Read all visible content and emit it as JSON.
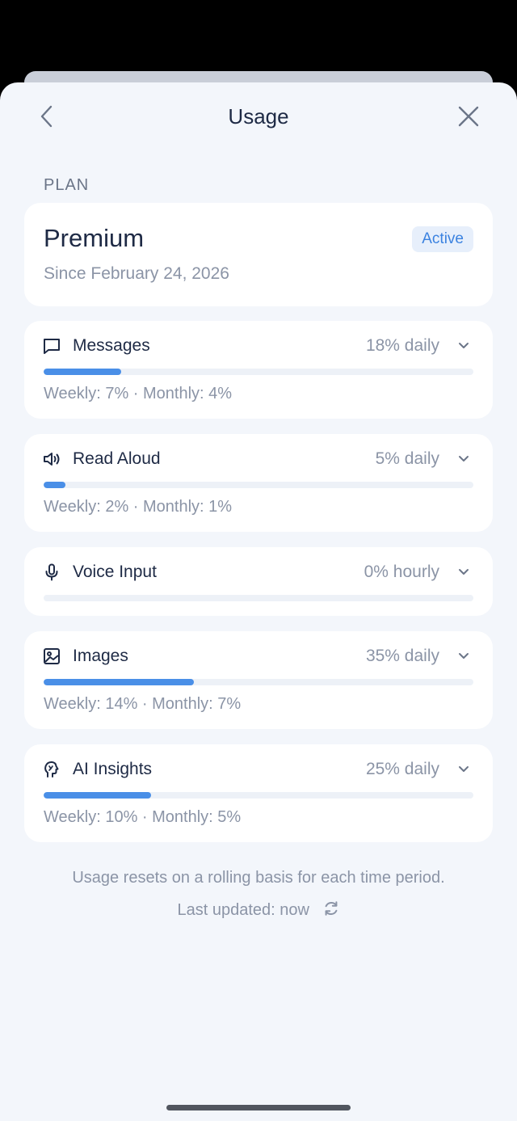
{
  "header": {
    "title": "Usage"
  },
  "plan": {
    "section_label": "PLAN",
    "name": "Premium",
    "since": "Since February 24, 2026",
    "status": "Active"
  },
  "usage": [
    {
      "icon": "message-icon",
      "name": "Messages",
      "summary": "18% daily",
      "progress": 0.18,
      "detail": "Weekly: 7% · Monthly: 4%"
    },
    {
      "icon": "speaker-icon",
      "name": "Read Aloud",
      "summary": "5% daily",
      "progress": 0.05,
      "detail": "Weekly: 2% · Monthly: 1%"
    },
    {
      "icon": "microphone-icon",
      "name": "Voice Input",
      "summary": "0% hourly",
      "progress": 0.0,
      "detail": ""
    },
    {
      "icon": "image-icon",
      "name": "Images",
      "summary": "35% daily",
      "progress": 0.35,
      "detail": "Weekly: 14% · Monthly: 7%"
    },
    {
      "icon": "ai-insights-icon",
      "name": "AI Insights",
      "summary": "25% daily",
      "progress": 0.25,
      "detail": "Weekly: 10% · Monthly: 5%"
    }
  ],
  "footer": {
    "note": "Usage resets on a rolling basis for each time period.",
    "updated": "Last updated: now"
  },
  "colors": {
    "accent": "#4a8fe7",
    "background": "#f3f6fb",
    "card": "#ffffff",
    "text_primary": "#1e2a45",
    "text_secondary": "#8b94a6"
  }
}
